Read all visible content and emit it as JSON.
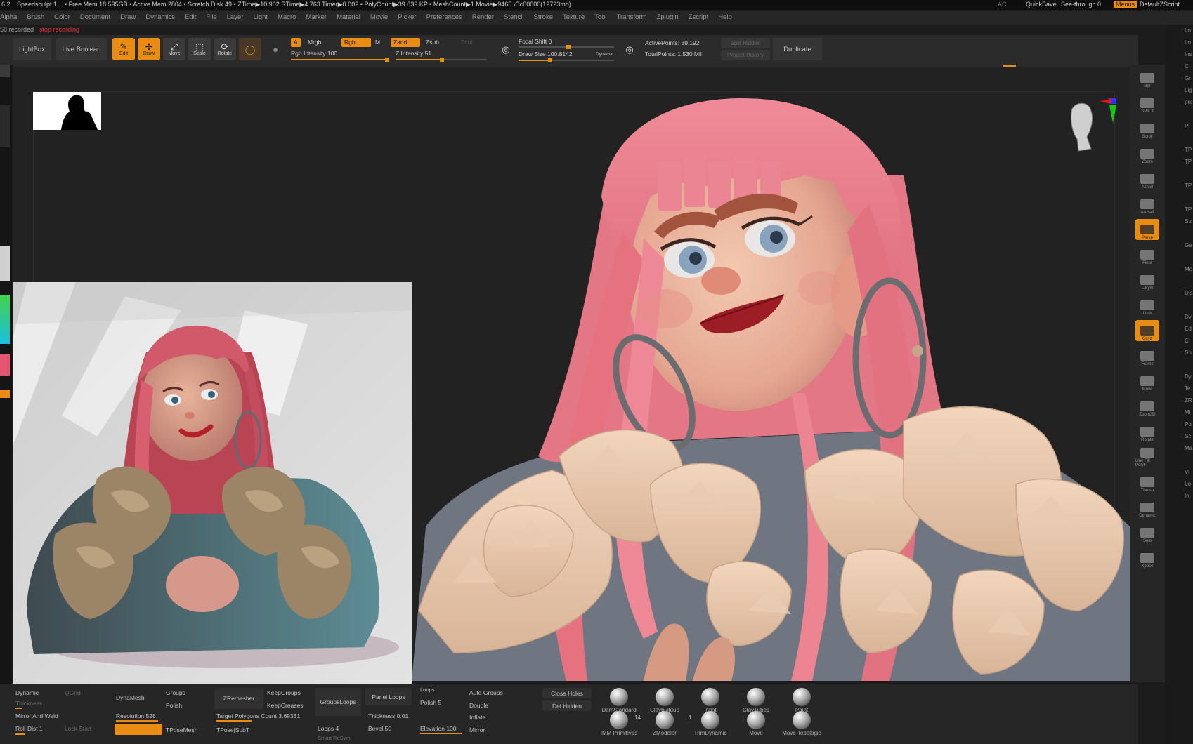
{
  "titlebar": {
    "version": "6.2",
    "doc": "Speedsculpt 1",
    "stats": "... • Free Mem 18.595GB • Active Mem 2804 • Scratch Disk 49 • ZTime▶10.902 RTime▶4.763 Timer▶0.002 • PolyCount▶39.839 KP • MeshCount▶1  Movie▶9465 \\Cc00000(12723mb)",
    "ac": "AC",
    "quicksave": "QuickSave",
    "seethrough": "See-through  0",
    "menus": "Menus",
    "script": "DefaultZScript"
  },
  "menubar": [
    "Alpha",
    "Brush",
    "Color",
    "Document",
    "Draw",
    "Dynamics",
    "Edit",
    "File",
    "Layer",
    "Light",
    "Macro",
    "Marker",
    "Material",
    "Movie",
    "Picker",
    "Preferences",
    "Render",
    "Stencil",
    "Stroke",
    "Texture",
    "Tool",
    "Transform",
    "Zplugin",
    "Zscript",
    "Help"
  ],
  "status": {
    "recorded": "58 recorded",
    "rec_red": "stop recording"
  },
  "shelf": {
    "lightbox": "LightBox",
    "live_boolean": "Live Boolean",
    "edit": "Edit",
    "draw": "Draw",
    "move": "Move",
    "scale": "Scale",
    "rotate": "Rotate",
    "a": "A",
    "mrgb": "Mrgb",
    "rgb": "Rgb",
    "m": "M",
    "zadd": "Zadd",
    "zsub": "Zsub",
    "zcut": "Zcut",
    "rgb_intensity": "Rgb Intensity 100",
    "z_intensity": "Z Intensity 51",
    "focal_shift": "Focal Shift 0",
    "draw_size": "Draw Size 100.8142",
    "dynamic": "Dynamic",
    "active_points": "ActivePoints: 39,192",
    "total_points": "TotalPoints: 1.530 Mil",
    "split_hidden": "Split Hidden",
    "project_history": "Project History",
    "duplicate": "Duplicate"
  },
  "right_tray": [
    "Bpr",
    "SPix 3",
    "Scroll",
    "Zoom",
    "Actual",
    "AAHalf",
    "Persp",
    "Floor",
    "L.Sym",
    "Lock",
    "Qxyz",
    "Frame",
    "Move",
    "Zoom3D",
    "Rotate",
    "Line Fill PolyF",
    "Transp",
    "Dynamic",
    "Solo",
    "Xpose"
  ],
  "far_right": [
    "Lo",
    "Lo",
    "Ins",
    "Cl",
    "Gr",
    "Lig",
    "pre",
    "",
    "Pl",
    "",
    "TP",
    "TP",
    "",
    "TP",
    "",
    "TP",
    "Su",
    "",
    "Ge",
    "",
    "Mo",
    "",
    "Dis",
    "",
    "Dy",
    "Ed",
    "Cr",
    "Sh",
    "",
    "Dy",
    "Te",
    "ZR",
    "Mi",
    "Po",
    "Sc",
    "Ma",
    "",
    "Vi",
    "Lo",
    "In"
  ],
  "bottom": {
    "dynamic": "Dynamic",
    "qgrid": "QGrid",
    "thickness": "Thickness",
    "mirror_weld": "Mirror And Weld",
    "roll_dist": "Roll Dist 1",
    "lock_start": "Lock Start",
    "dynamesh": "DynaMesh",
    "groups": "Groups",
    "polish": "Polish",
    "resolution": "Resolution 528",
    "tposemesh": "TPoseMesh",
    "zremesher": "ZRemesher",
    "keepgroups": "KeepGroups",
    "keepcreases": "KeepCreases",
    "target_poly": "Target Polygons Count 3.69331",
    "tpose_subt": "TPose|SubT",
    "groupsloops": "GroupsLoops",
    "panel_loops": "Panel Loops",
    "thickness2": "Thickness 0.01",
    "loops4": "Loops 4",
    "bevel": "Bevel 50",
    "smart_resym": "Smart ReSym",
    "loops": "Loops",
    "polish5": "Polish 5",
    "elevation": "Elevation 100",
    "auto_groups": "Auto Groups",
    "double": "Double",
    "inflate": "Inflate",
    "mirror": "Mirror",
    "close_holes": "Close Holes",
    "del_hidden": "Del Hidden",
    "count14": "14",
    "count1": "1"
  },
  "brushes": [
    "DamStandard",
    "Claybuildup",
    "Inflat",
    "ClayTubes",
    "Paint",
    "IMM Primitives",
    "ZModeler",
    "TrimDynamic",
    "Move",
    "Move Topologic"
  ],
  "colors": {
    "accent": "#e98d12",
    "hair": "#e8798a",
    "fur": "#e9c5a6",
    "bg": "#222222"
  }
}
